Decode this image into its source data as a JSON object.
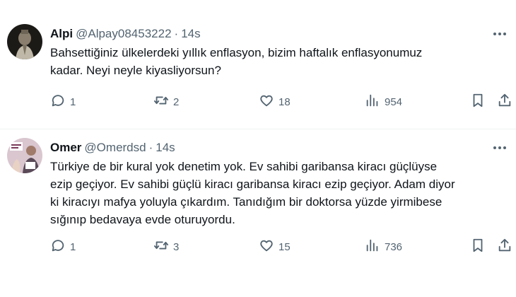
{
  "tweets": [
    {
      "author": "Alpi",
      "handle": "@Alpay08453222",
      "separator": "·",
      "time": "14s",
      "text_lines": [
        "Bahsettiğiniz ülkelerdeki yıllık enflasyon,  bizim haftalık enflasyonumuz",
        "kadar. Neyi neyle kiyasliyorsun?"
      ],
      "stats": {
        "replies": "1",
        "retweets": "2",
        "likes": "18",
        "views": "954"
      }
    },
    {
      "author": "Omer",
      "handle": "@Omerdsd",
      "separator": "·",
      "time": "14s",
      "text_lines": [
        "Türkiye de bir kural yok denetim yok. Ev sahibi garibansa kiracı güçlüyse",
        "ezip geçiyor. Ev sahibi güçlü kiracı garibansa kiracı ezip geçiyor. Adam diyor",
        "ki kiracıyı mafya yoluyla çıkardım. Tanıdığım bir doktorsa yüzde yirmibese",
        "sığınıp bedavaya evde oturuyordu."
      ],
      "stats": {
        "replies": "1",
        "retweets": "3",
        "likes": "15",
        "views": "736"
      }
    }
  ],
  "icons": {
    "reply": "reply-icon",
    "retweet": "retweet-icon",
    "like": "heart-icon",
    "views": "views-icon",
    "bookmark": "bookmark-icon",
    "share": "share-icon",
    "more": "more-icon"
  },
  "colors": {
    "text": "#0f1419",
    "secondary": "#536471",
    "divider": "#eff3f4"
  }
}
